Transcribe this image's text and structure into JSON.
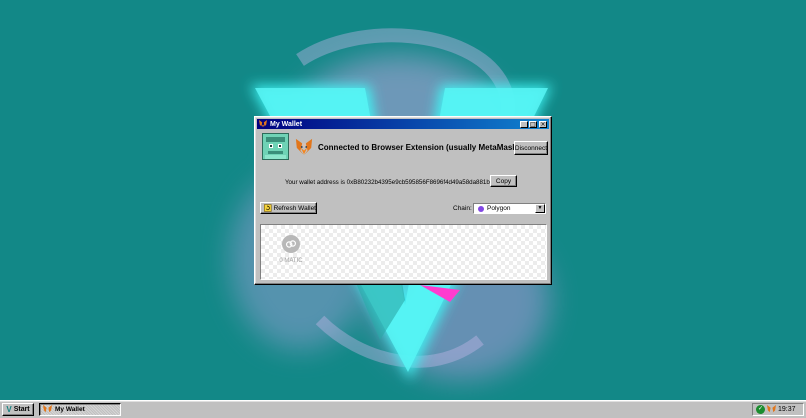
{
  "window": {
    "title": "My Wallet",
    "controls": {
      "minimize": "_",
      "maximize": "□",
      "close": "×"
    }
  },
  "connection": {
    "status_text": "Connected to Browser Extension (usually MetaMask).",
    "disconnect_label": "Disconnect"
  },
  "address": {
    "text": "Your wallet address is 0xB80232b4395e9cb595856F8696f4d49a58da881b",
    "copy_label": "Copy"
  },
  "actions": {
    "refresh_label": "Refresh Wallet"
  },
  "chain": {
    "label": "Chain:",
    "selected": "Polygon",
    "icon": "polygon-icon",
    "color": "#8247e5"
  },
  "tokens": [
    {
      "symbol": "0 MATIC",
      "icon": "matic-icon"
    }
  ],
  "taskbar": {
    "start_label": "Start",
    "task_label": "My Wallet",
    "clock": "19:37"
  },
  "colors": {
    "desktop": "#128887",
    "titlebar": "#000080",
    "accent_cyan": "#3ff6f6",
    "accent_magenta": "#ff3ccf"
  }
}
